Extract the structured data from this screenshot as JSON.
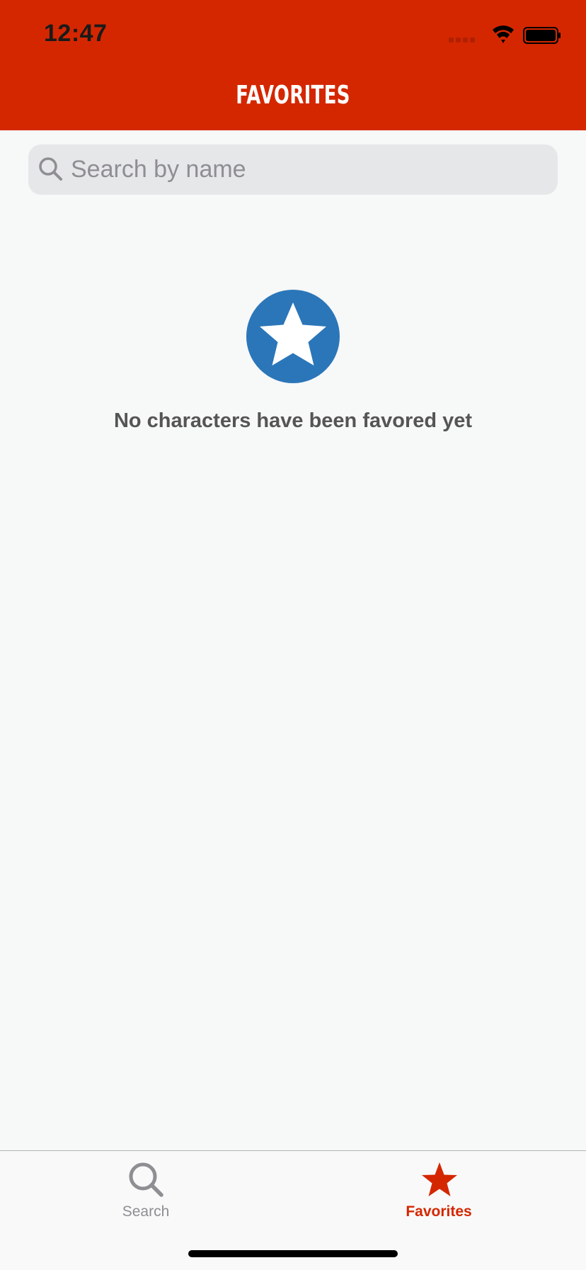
{
  "status_bar": {
    "time": "12:47"
  },
  "header": {
    "title": "Favorites"
  },
  "search": {
    "placeholder": "Search by name",
    "value": ""
  },
  "empty_state": {
    "icon": "star-circle-icon",
    "message": "No characters have been favored yet"
  },
  "tab_bar": {
    "tabs": [
      {
        "label": "Search",
        "icon": "search-icon",
        "active": false
      },
      {
        "label": "Favorites",
        "icon": "star-icon",
        "active": true
      }
    ]
  },
  "colors": {
    "accent": "#d42700",
    "empty_icon": "#2b76b9",
    "background": "#f7f8f8",
    "inactive_tab": "#8e8e93"
  }
}
